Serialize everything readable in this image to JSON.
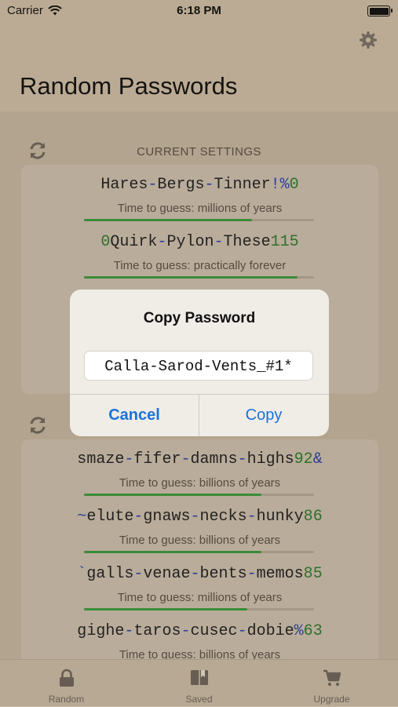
{
  "status": {
    "carrier": "Carrier",
    "time": "6:18 PM"
  },
  "header": {
    "title": "Random Passwords"
  },
  "current_settings": {
    "label": "CURRENT SETTINGS",
    "items": [
      {
        "password": "Hares-Bergs-Tinner!%0",
        "time_to_guess": "Time to guess: millions of years",
        "strength": 0.73
      },
      {
        "password": "0Quirk-Pylon-These115",
        "time_to_guess": "Time to guess: practically forever",
        "strength": 0.93
      }
    ]
  },
  "second_group": {
    "items": [
      {
        "password": "smaze-fifer-damns-highs92&",
        "time_to_guess": "Time to guess: billions of years",
        "strength": 0.77
      },
      {
        "password": "~elute-gnaws-necks-hunky86",
        "time_to_guess": "Time to guess: billions of years",
        "strength": 0.77
      },
      {
        "password": "`galls-venae-bents-memos85",
        "time_to_guess": "Time to guess: millions of years",
        "strength": 0.71
      },
      {
        "password": "gighe-taros-cusec-dobie%63",
        "time_to_guess": "Time to guess: billions of years",
        "strength": 0.77
      }
    ]
  },
  "dialog": {
    "title": "Copy Password",
    "field_value": "Calla-Sarod-Vents_#1*",
    "cancel_label": "Cancel",
    "copy_label": "Copy"
  },
  "tabbar": {
    "tabs": [
      {
        "label": "Random",
        "icon": "lock-icon"
      },
      {
        "label": "Saved",
        "icon": "book-icon"
      },
      {
        "label": "Upgrade",
        "icon": "cart-icon"
      }
    ]
  },
  "colors": {
    "accent": "#1a73d9",
    "digit": "#2e7a2e",
    "symbol": "#2a3fa8",
    "strength": "#3c9a3c"
  }
}
